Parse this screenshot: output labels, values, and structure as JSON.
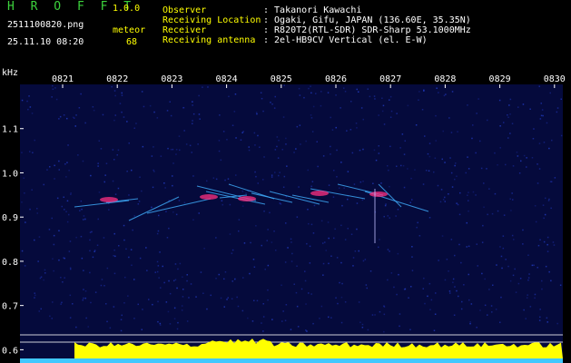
{
  "header": {
    "brand": "H R O F F T",
    "version": "1.0.0",
    "filename": "2511100820.png",
    "timestamp": "25.11.10 08:20",
    "meteor_label": "meteor",
    "meteor_count": "68",
    "info": [
      {
        "key": "Observer",
        "value": ": Takanori Kawachi"
      },
      {
        "key": "Receiving Location",
        "value": ": Ogaki, Gifu, JAPAN (136.60E, 35.35N)"
      },
      {
        "key": "Receiver",
        "value": ": R820T2(RTL-SDR) SDR-Sharp 53.1000MHz"
      },
      {
        "key": "Receiving antenna",
        "value": ": 2el-HB9CV Vertical (el. E-W)"
      }
    ]
  },
  "axes": {
    "y_unit": "kHz",
    "y_ticks": [
      "1.1",
      "1.0",
      "0.9",
      "0.8",
      "0.7",
      "0.6"
    ],
    "x_ticks": [
      "0821",
      "0822",
      "0823",
      "0824",
      "0825",
      "0826",
      "0827",
      "0828",
      "0829",
      "0830"
    ]
  },
  "colors": {
    "background": "#000000",
    "plot_bg": "#050a3c",
    "brand": "#3cd23c",
    "accent": "#ffff00",
    "carrier": "#40e0a0",
    "echo": "#ff3080",
    "activity": "#ffff00",
    "baseline": "#40c8ff"
  },
  "chart_data": {
    "type": "heatmap",
    "ylim": [
      0.57,
      1.2
    ],
    "carrier_kHz": 0.92,
    "x": [
      "0821",
      "0822",
      "0823",
      "0824",
      "0825",
      "0826",
      "0827",
      "0828",
      "0829",
      "0830"
    ]
  }
}
